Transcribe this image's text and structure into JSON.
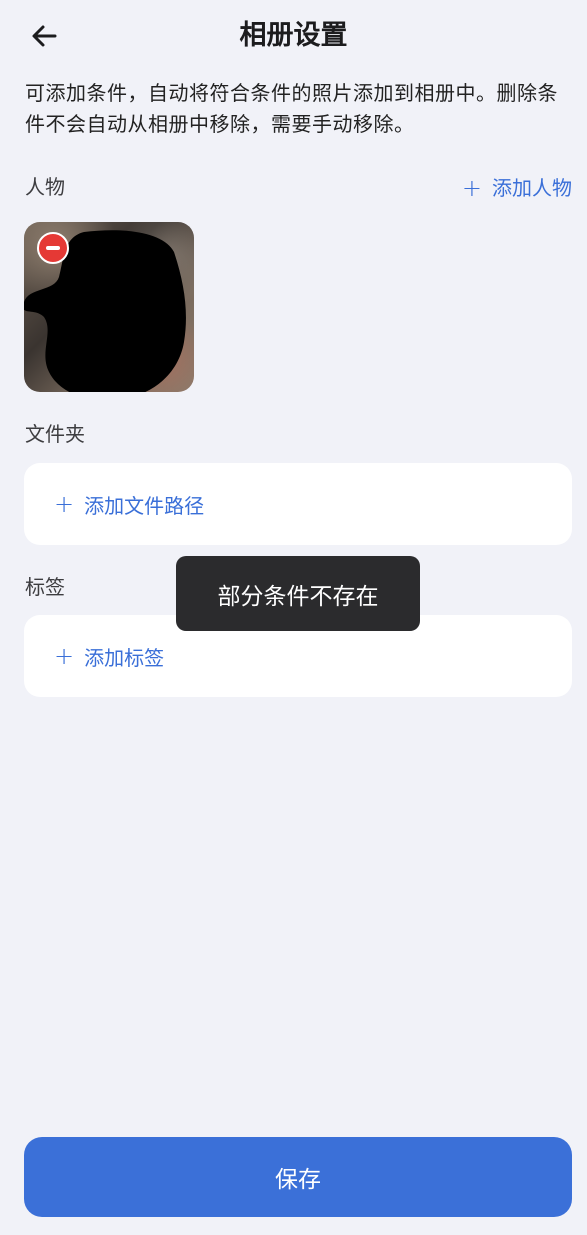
{
  "header": {
    "title": "相册设置",
    "back_icon": "arrow-left-icon"
  },
  "description": "可添加条件，自动将符合条件的照片添加到相册中。删除条件不会自动从相册中移除，需要手动移除。",
  "people": {
    "label": "人物",
    "add_label": "添加人物",
    "remove_icon": "remove-icon"
  },
  "folder": {
    "label": "文件夹",
    "add_label": "添加文件路径"
  },
  "tags": {
    "label": "标签",
    "add_label": "添加标签"
  },
  "toast": {
    "message": "部分条件不存在"
  },
  "footer": {
    "save_label": "保存"
  },
  "plus_symbol": "+",
  "colors": {
    "background": "#f1f2f8",
    "accent": "#3a6fd8",
    "remove": "#e53935",
    "toast": "#2b2b2d"
  }
}
